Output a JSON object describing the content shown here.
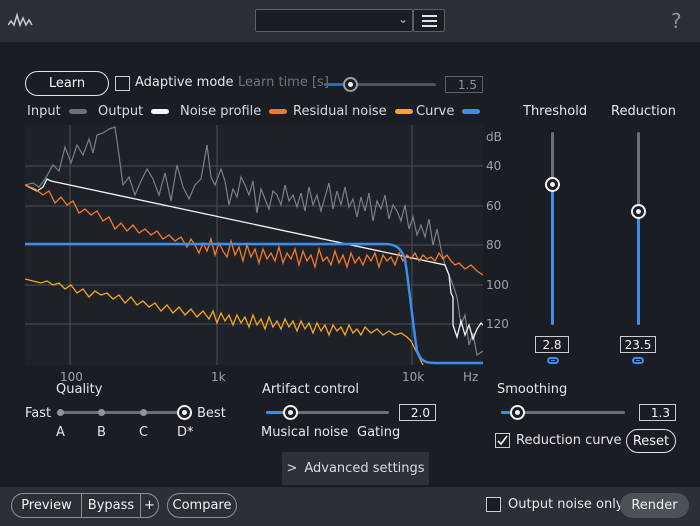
{
  "header": {
    "logo_icon": "waveform-logo-icon",
    "preset_value": "",
    "menu_icon": "hamburger-menu-icon",
    "help_label": "?"
  },
  "learn": {
    "button_label": "Learn",
    "adaptive_mode_label": "Adaptive mode",
    "adaptive_mode_checked": false,
    "learn_time_label": "Learn time [s]",
    "learn_time_value": "1.5"
  },
  "legend": [
    {
      "label": "Input",
      "color": "#6d7278"
    },
    {
      "label": "Output",
      "color": "#f2f4f6"
    },
    {
      "label": "Noise profile",
      "color": "#f07a2a"
    },
    {
      "label": "Residual noise",
      "color": "#f5a623"
    },
    {
      "label": "Curve",
      "color": "#3d8ee8"
    }
  ],
  "graph": {
    "y_unit": "dB",
    "y_ticks": [
      "40",
      "60",
      "80",
      "100",
      "120"
    ],
    "x_ticks": [
      "100",
      "1k",
      "10k"
    ],
    "x_unit": "Hz"
  },
  "threshold": {
    "label": "Threshold",
    "value": "2.8",
    "level": 0.76
  },
  "reduction": {
    "label": "Reduction",
    "value": "23.5",
    "level": 0.6
  },
  "quality": {
    "label": "Quality",
    "min_label": "Fast",
    "max_label": "Best",
    "options": [
      "A",
      "B",
      "C",
      "D*"
    ],
    "selected": "D*"
  },
  "artifact": {
    "label": "Artifact control",
    "value": "2.0",
    "left_label": "Musical noise",
    "right_label": "Gating",
    "level": 0.2
  },
  "smoothing": {
    "label": "Smoothing",
    "value": "1.3",
    "level": 0.13,
    "reduction_curve_label": "Reduction curve",
    "reduction_curve_checked": true,
    "reset_label": "Reset"
  },
  "advanced": {
    "label": "Advanced settings"
  },
  "footer": {
    "preview_label": "Preview",
    "bypass_label": "Bypass",
    "plus_label": "+",
    "compare_label": "Compare",
    "output_noise_label": "Output noise only",
    "output_noise_checked": false,
    "render_label": "Render"
  }
}
